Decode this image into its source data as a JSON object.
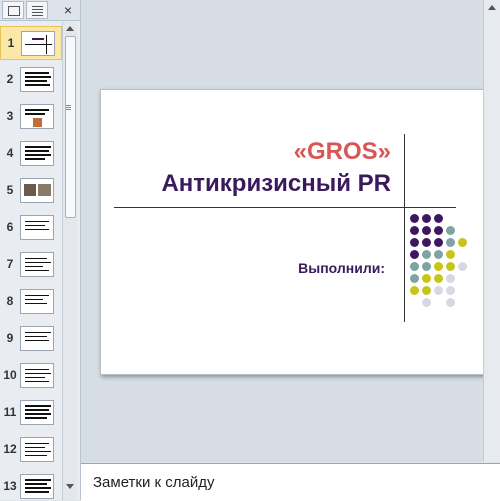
{
  "thumbnails_panel": {
    "close_label": "×",
    "slides": [
      {
        "num": "1"
      },
      {
        "num": "2"
      },
      {
        "num": "3"
      },
      {
        "num": "4"
      },
      {
        "num": "5"
      },
      {
        "num": "6"
      },
      {
        "num": "7"
      },
      {
        "num": "8"
      },
      {
        "num": "9"
      },
      {
        "num": "10"
      },
      {
        "num": "11"
      },
      {
        "num": "12"
      },
      {
        "num": "13"
      }
    ],
    "selected_slide": 1
  },
  "slide": {
    "title_line1": "«GROS»",
    "title_line2": "Антикризисный  PR",
    "authors_label": "Выполнили:",
    "colors": {
      "title_accent": "#d85656",
      "title_main": "#3a1a5c",
      "dot_purple": "#3d1860",
      "dot_teal": "#7fa3a2",
      "dot_yellow": "#c8c41c",
      "dot_gray": "#d8d8e4"
    }
  },
  "notes": {
    "placeholder": "Заметки к слайду"
  }
}
